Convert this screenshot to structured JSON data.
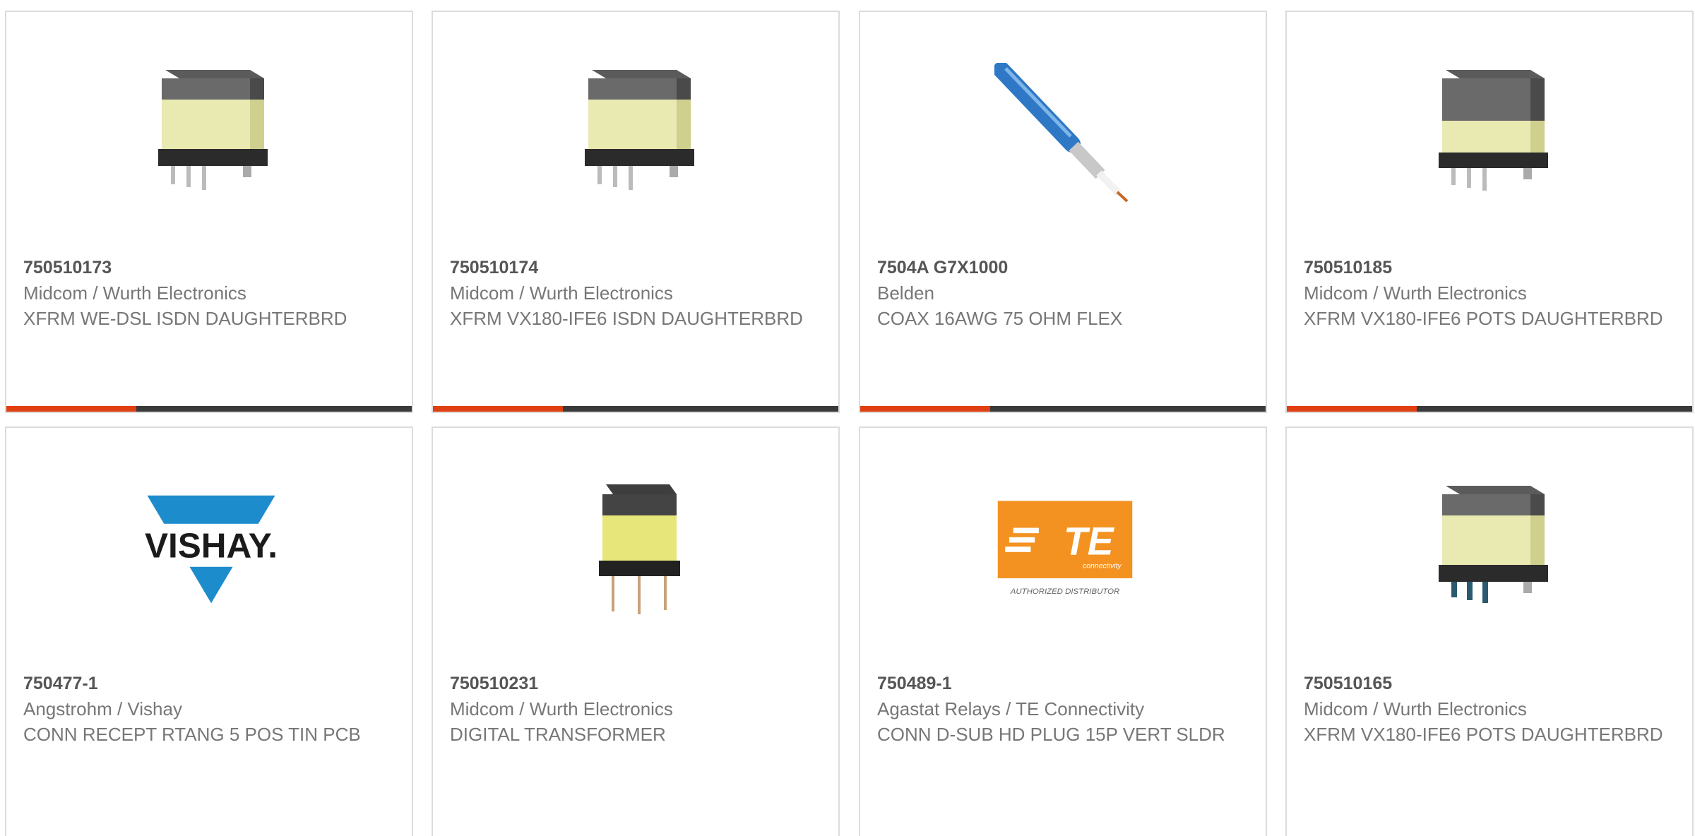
{
  "products": [
    {
      "pn": "750510173",
      "mfr": "Midcom / Wurth Electronics",
      "desc": "XFRM WE-DSL ISDN DAUGHTERBRD",
      "image": "transformer-smd-icon"
    },
    {
      "pn": "750510174",
      "mfr": "Midcom / Wurth Electronics",
      "desc": "XFRM VX180-IFE6 ISDN DAUGHTERBRD",
      "image": "transformer-smd-icon"
    },
    {
      "pn": "7504A G7X1000",
      "mfr": "Belden",
      "desc": "COAX 16AWG 75 OHM FLEX",
      "image": "coax-cable-icon"
    },
    {
      "pn": "750510185",
      "mfr": "Midcom / Wurth Electronics",
      "desc": "XFRM VX180-IFE6 POTS DAUGHTERBRD",
      "image": "transformer-smd-icon"
    },
    {
      "pn": "750477-1",
      "mfr": "Angstrohm / Vishay",
      "desc": "CONN RECEPT RTANG 5 POS TIN PCB",
      "image": "vishay-logo",
      "logo_text": "VISHAY."
    },
    {
      "pn": "750510231",
      "mfr": "Midcom / Wurth Electronics",
      "desc": "DIGITAL TRANSFORMER",
      "image": "transformer-tht-icon"
    },
    {
      "pn": "750489-1",
      "mfr": "Agastat Relays / TE Connectivity",
      "desc": "CONN D-SUB HD PLUG 15P VERT SLDR",
      "image": "te-connectivity-logo",
      "logo_text": "TE",
      "logo_sub": "connectivity",
      "logo_caption": "AUTHORIZED DISTRIBUTOR"
    },
    {
      "pn": "750510165",
      "mfr": "Midcom / Wurth Electronics",
      "desc": "XFRM VX180-IFE6 POTS DAUGHTERBRD",
      "image": "transformer-smd-icon"
    }
  ],
  "colors": {
    "accent": "#e04011",
    "bar": "#3a3a3a",
    "border": "#dcdcdc",
    "text": "#777777"
  }
}
